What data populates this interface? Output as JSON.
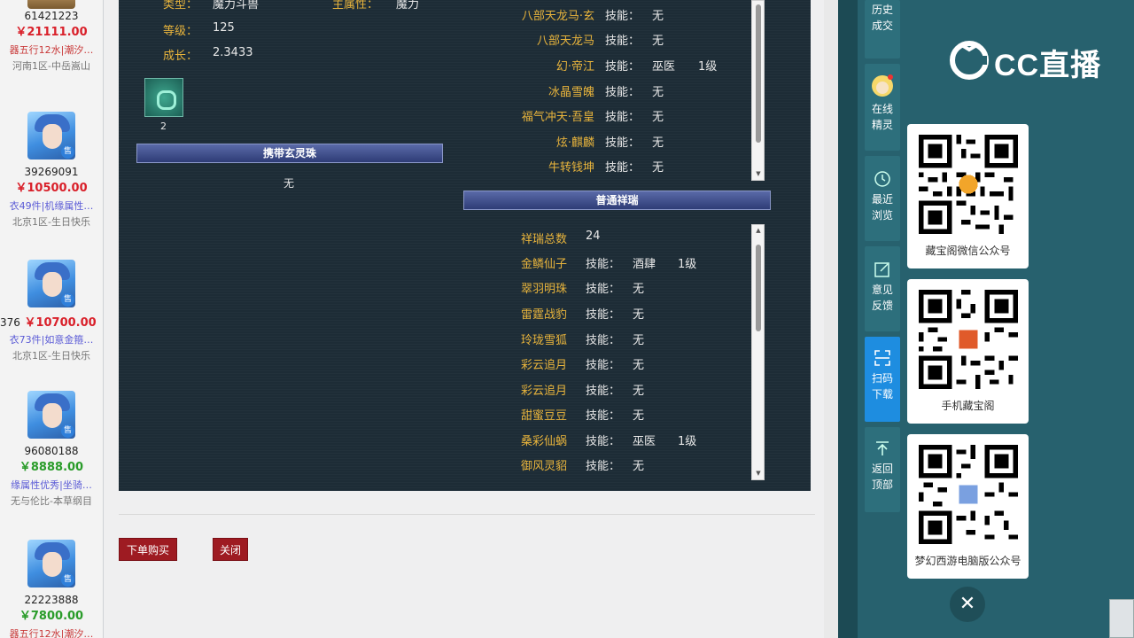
{
  "listings": [
    {
      "id": "61421223",
      "price": "￥21111.00",
      "desc": "器五行12水|潮汐…",
      "server": "河南1区-中岳嵩山",
      "price_color": "red",
      "desc_color": "red"
    },
    {
      "id": "39269091",
      "price": "￥10500.00",
      "desc": "衣49件|机缘属性…",
      "server": "北京1区-生日快乐",
      "price_color": "red",
      "desc_color": "blue"
    },
    {
      "id": "376",
      "price": "￥10700.00",
      "desc": "衣73件|如意金箍…",
      "server": "北京1区-生日快乐",
      "price_color": "red",
      "desc_color": "blue"
    },
    {
      "id": "96080188",
      "price": "￥8888.00",
      "desc": "缘属性优秀|坐骑…",
      "server": "无与伦比-本草纲目",
      "price_color": "green",
      "desc_color": "blue"
    },
    {
      "id": "22223888",
      "price": "￥7800.00",
      "desc": "器五行12水|潮汐…",
      "server": "",
      "price_color": "green",
      "desc_color": "red"
    }
  ],
  "avatar_badge": "售",
  "pet_info": {
    "type_label": "类型：",
    "type_value": "魔力斗兽",
    "attr_label": "主属性：",
    "attr_value": "魔力",
    "level_label": "等级：",
    "level_value": "125",
    "growth_label": "成长：",
    "growth_value": "2.3433",
    "skill_count": "2"
  },
  "carry_orb": {
    "header": "携带玄灵珠",
    "value": "无"
  },
  "rare_mounts": [
    {
      "name": "八部天龙马·玄",
      "skill_label": "技能：",
      "skill": "无",
      "level": ""
    },
    {
      "name": "八部天龙马",
      "skill_label": "技能：",
      "skill": "无",
      "level": ""
    },
    {
      "name": "幻·帝江",
      "skill_label": "技能：",
      "skill": "巫医",
      "level": "1级"
    },
    {
      "name": "冰晶雪魄",
      "skill_label": "技能：",
      "skill": "无",
      "level": ""
    },
    {
      "name": "福气冲天·吾皇",
      "skill_label": "技能：",
      "skill": "无",
      "level": ""
    },
    {
      "name": "炫·麒麟",
      "skill_label": "技能：",
      "skill": "无",
      "level": ""
    },
    {
      "name": "牛转钱坤",
      "skill_label": "技能：",
      "skill": "无",
      "level": ""
    }
  ],
  "common_xiangrui": {
    "header": "普通祥瑞",
    "total_label": "祥瑞总数",
    "total_value": "24",
    "items": [
      {
        "name": "金鳞仙子",
        "skill_label": "技能：",
        "skill": "酒肆",
        "level": "1级"
      },
      {
        "name": "翠羽明珠",
        "skill_label": "技能：",
        "skill": "无",
        "level": ""
      },
      {
        "name": "雷霆战豹",
        "skill_label": "技能：",
        "skill": "无",
        "level": ""
      },
      {
        "name": "玲珑雪狐",
        "skill_label": "技能：",
        "skill": "无",
        "level": ""
      },
      {
        "name": "彩云追月",
        "skill_label": "技能：",
        "skill": "无",
        "level": ""
      },
      {
        "name": "彩云追月",
        "skill_label": "技能：",
        "skill": "无",
        "level": ""
      },
      {
        "name": "甜蜜豆豆",
        "skill_label": "技能：",
        "skill": "无",
        "level": ""
      },
      {
        "name": "桑彩仙蜗",
        "skill_label": "技能：",
        "skill": "巫医",
        "level": "1级"
      },
      {
        "name": "御风灵貂",
        "skill_label": "技能：",
        "skill": "无",
        "level": ""
      }
    ]
  },
  "actions": {
    "buy": "下单购买",
    "close": "关闭"
  },
  "side_rail": [
    {
      "label_1": "历史",
      "label_2": "成交",
      "icon": "history-icon"
    },
    {
      "label_1": "在线",
      "label_2": "精灵",
      "icon": "sprite-icon"
    },
    {
      "label_1": "最近",
      "label_2": "浏览",
      "icon": "clock-icon"
    },
    {
      "label_1": "意见",
      "label_2": "反馈",
      "icon": "edit-icon"
    },
    {
      "label_1": "扫码",
      "label_2": "下载",
      "icon": "scan-icon"
    },
    {
      "label_1": "返回",
      "label_2": "顶部",
      "icon": "arrow-up-icon"
    }
  ],
  "qr_cards": [
    {
      "caption": "藏宝阁微信公众号"
    },
    {
      "caption": "手机藏宝阁"
    },
    {
      "caption": "梦幻西游电脑版公众号"
    }
  ],
  "logo_text": "CC直播",
  "close_glyph": "✕"
}
